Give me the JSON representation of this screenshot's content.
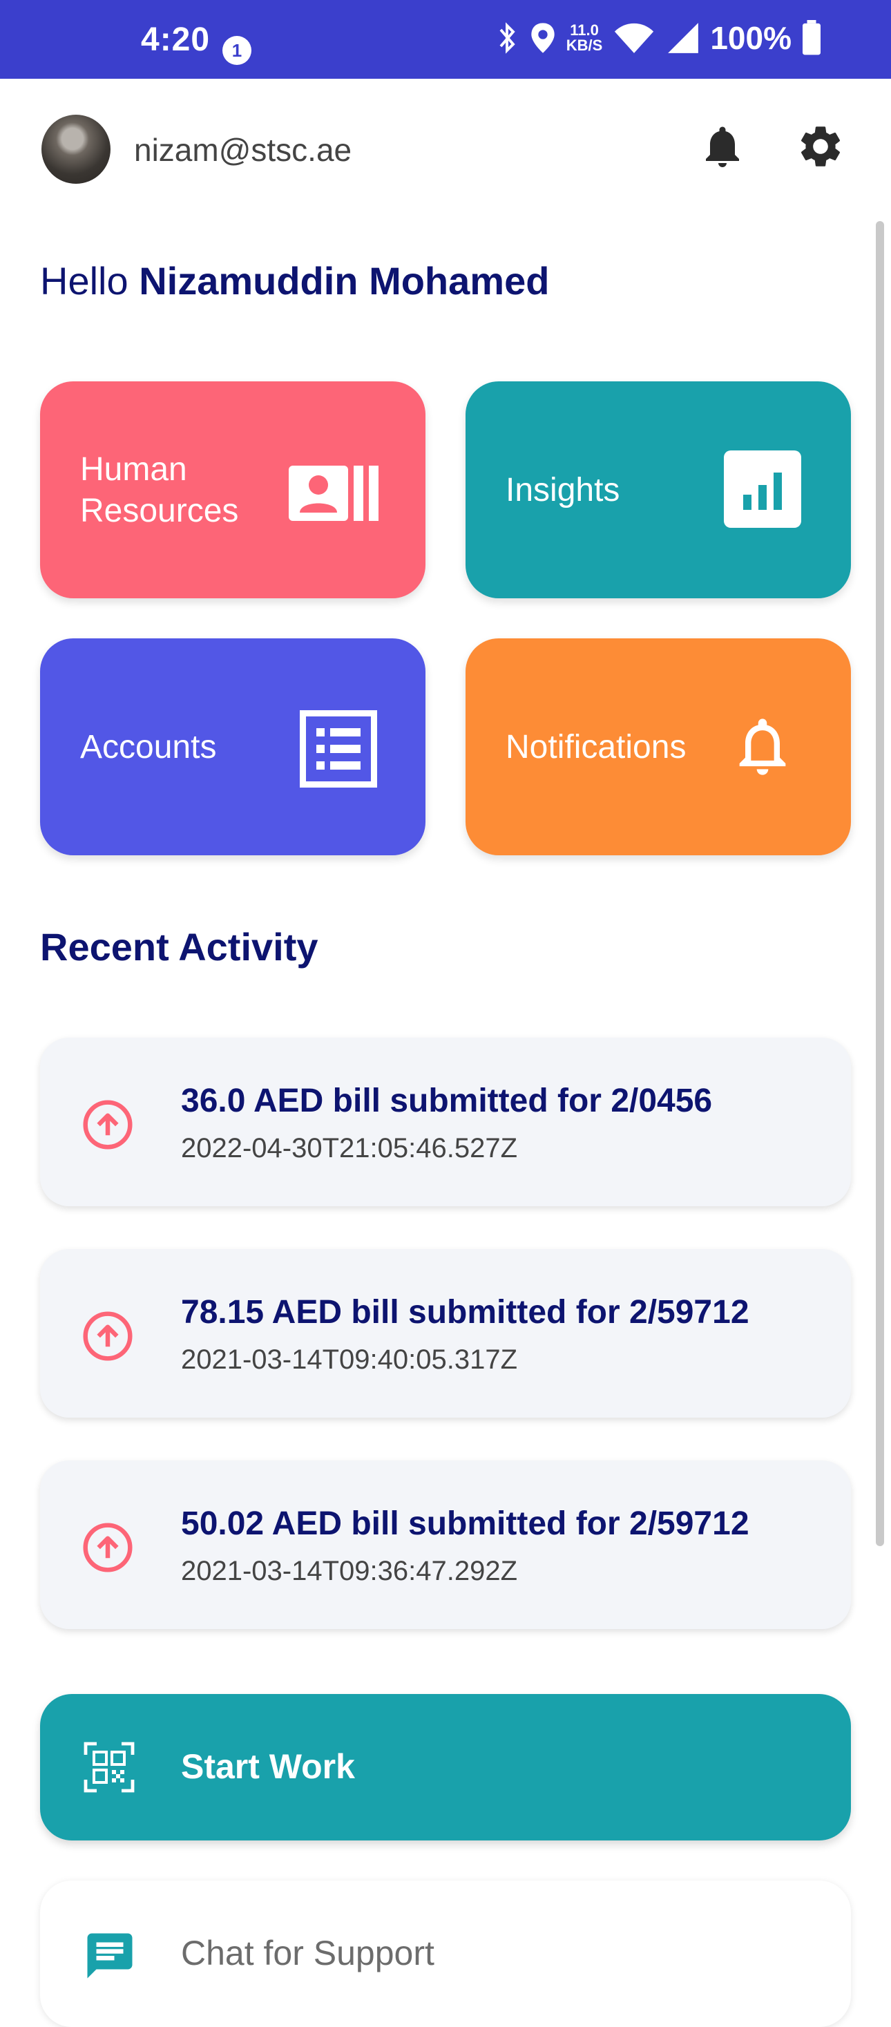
{
  "status_bar": {
    "time": "4:20",
    "notification_count": "1",
    "net_speed_value": "11.0",
    "net_speed_unit": "KB/S",
    "battery": "100%",
    "color": "#3b3fcc"
  },
  "header": {
    "email": "nizam@stsc.ae",
    "icons": [
      "bell-icon",
      "gear-icon"
    ]
  },
  "greeting": {
    "prefix": "Hello",
    "name": "Nizamuddin Mohamed"
  },
  "tiles": [
    {
      "label": "Human Resources",
      "color": "#fd6577",
      "icon": "id-card-icon"
    },
    {
      "label": "Insights",
      "color": "#19a1ab",
      "icon": "chart-icon"
    },
    {
      "label": "Accounts",
      "color": "#5257e6",
      "icon": "list-icon"
    },
    {
      "label": "Notifications",
      "color": "#fd8c36",
      "icon": "bell-icon"
    }
  ],
  "recent": {
    "title": "Recent Activity",
    "items": [
      {
        "title": "36.0 AED bill submitted for 2/0456",
        "time": "2022-04-30T21:05:46.527Z"
      },
      {
        "title": "78.15 AED bill submitted for 2/59712",
        "time": "2021-03-14T09:40:05.317Z"
      },
      {
        "title": "50.02 AED bill submitted for 2/59712",
        "time": "2021-03-14T09:36:47.292Z"
      }
    ]
  },
  "actions": {
    "start_work": "Start Work",
    "chat_support": "Chat for Support"
  }
}
